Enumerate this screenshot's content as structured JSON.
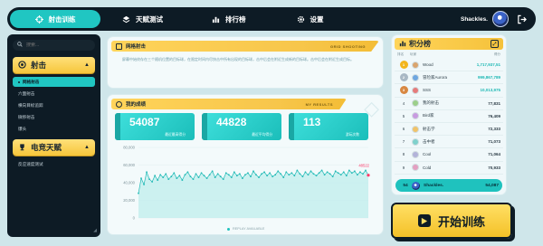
{
  "nav": {
    "tabs": [
      {
        "label": "射击训练",
        "icon": "crosshair-icon",
        "active": true
      },
      {
        "label": "天赋测试",
        "icon": "layers-icon",
        "active": false
      },
      {
        "label": "排行榜",
        "icon": "bar-chart-icon",
        "active": false
      },
      {
        "label": "设置",
        "icon": "gear-icon",
        "active": false
      }
    ],
    "user_name": "Shackles.",
    "logout_icon": "logout-icon"
  },
  "sidebar": {
    "search_placeholder": "搜索...",
    "categories": [
      {
        "label": "射击",
        "expanded": true,
        "items": [
          {
            "label": "网格射击",
            "active": true
          },
          {
            "label": "六面射击",
            "active": false
          },
          {
            "label": "横向目标追踪",
            "active": false
          },
          {
            "label": "微移射击",
            "active": false
          },
          {
            "label": "爆头",
            "active": false
          }
        ]
      },
      {
        "label": "电竞天赋",
        "expanded": true,
        "items": [
          {
            "label": "反应速度测试",
            "active": false
          }
        ]
      }
    ]
  },
  "task": {
    "title": "网格射击",
    "tag": "GRID SHOOTING",
    "description": "屏幕中始终存在三个随机位置的目标球，在限定时间内尽快击中所有出现的目标球，击中后会在附近生成新的目标球。击中后会在附近生成目标。"
  },
  "results": {
    "title": "我的成绩",
    "tag": "MY RESULTS",
    "stats": [
      {
        "value": "54087",
        "label": "最近最高得分"
      },
      {
        "value": "44828",
        "label": "最近平均得分"
      },
      {
        "value": "113",
        "label": "游玩次数"
      }
    ],
    "replay_text": "REPLAY AVAILABLE"
  },
  "chart_data": {
    "type": "area",
    "y_ticks": [
      "80,000",
      "60,000",
      "40,000",
      "20,000",
      "0"
    ],
    "ylim": [
      0,
      80000
    ],
    "highlight_label": "48522",
    "series": [
      {
        "values": [
          28000,
          45000,
          38000,
          52000,
          44000,
          41000,
          48000,
          43000,
          49000,
          46000,
          50000,
          44000,
          47000,
          51000,
          45000,
          48000,
          43000,
          49000,
          52000,
          47000,
          44000,
          50000,
          46000,
          51000,
          48000,
          45000,
          49000,
          53000,
          46000,
          50000,
          47000,
          44000,
          51000,
          49000,
          46000,
          52000,
          48000,
          50000,
          45000,
          49000,
          51000,
          47000,
          53000,
          49000,
          46000,
          50000,
          52000,
          48000,
          51000,
          47000,
          49000,
          53000,
          50000,
          46000,
          52000,
          49000,
          51000,
          48000,
          54000,
          50000,
          47000,
          52000,
          49000,
          53000,
          50000,
          48000,
          51000,
          54000,
          49000,
          52000,
          50000,
          47000,
          53000,
          51000,
          49000,
          52000,
          48000,
          54000,
          51000,
          53000,
          49000,
          52000,
          50000,
          54000,
          48522
        ]
      }
    ],
    "colors": {
      "line": "#1fb9b5",
      "fill": "#bfeeec",
      "last_point": "#ff3b6b"
    }
  },
  "leaderboard": {
    "title": "积分榜",
    "headers": {
      "rank": "排名",
      "player": "玩家",
      "score": "得分"
    },
    "rows": [
      {
        "rank": "1",
        "name": "Wood",
        "score": "1,717,937,51",
        "medal": "#f2b51c"
      },
      {
        "rank": "2",
        "name": "冒险家Aurora",
        "score": "999,867,789",
        "medal": "#a9b8c4"
      },
      {
        "rank": "3",
        "name": "SSS",
        "score": "10,013,975",
        "medal": "#d88842"
      },
      {
        "rank": "4",
        "name": "我的射击",
        "score": "77,831"
      },
      {
        "rank": "5",
        "name": "Bird家",
        "score": "76,409"
      },
      {
        "rank": "6",
        "name": "射击学",
        "score": "72,333"
      },
      {
        "rank": "7",
        "name": "击中者",
        "score": "71,073"
      },
      {
        "rank": "8",
        "name": "Cool",
        "score": "71,064"
      },
      {
        "rank": "9",
        "name": "Cold",
        "score": "70,933"
      }
    ],
    "me": {
      "rank": "54",
      "name": "Shackles.",
      "score": "54,087"
    }
  },
  "start_button": {
    "label": "开始训练"
  }
}
